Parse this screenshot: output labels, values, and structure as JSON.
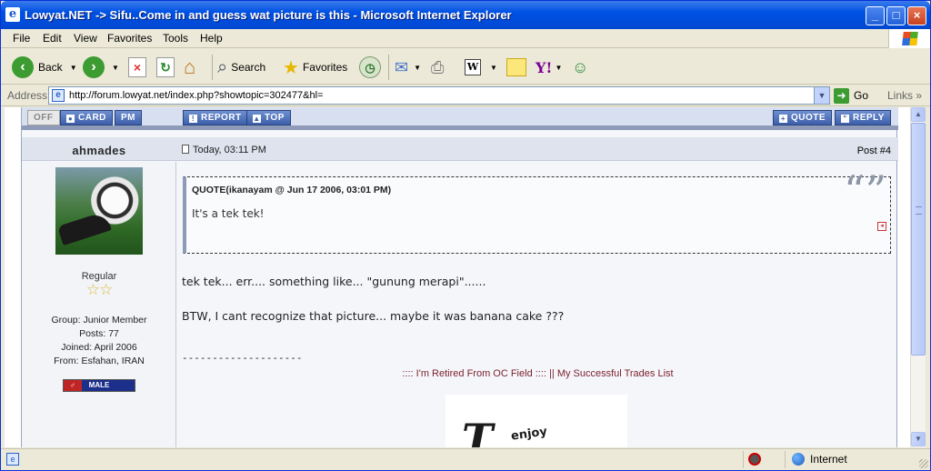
{
  "window": {
    "title": "Lowyat.NET -> Sifu..Come in and guess wat picture is this - Microsoft Internet Explorer"
  },
  "menu": [
    "File",
    "Edit",
    "View",
    "Favorites",
    "Tools",
    "Help"
  ],
  "toolbar": {
    "back": "Back",
    "search": "Search",
    "favorites": "Favorites"
  },
  "address": {
    "label": "Address",
    "url": "http://forum.lowyat.net/index.php?showtopic=302477&hl=",
    "go": "Go",
    "links": "Links"
  },
  "forum": {
    "buttons": {
      "off": "OFF",
      "card": "CARD",
      "pm": "PM",
      "report": "REPORT",
      "top": "TOP",
      "quote": "QUOTE",
      "reply": "REPLY"
    },
    "post": {
      "username": "ahmades",
      "date": "Today, 03:11 PM",
      "number": "Post #4",
      "rank": "Regular",
      "group": "Group: Junior Member",
      "posts": "Posts: 77",
      "joined": "Joined: April 2006",
      "from": "From: Esfahan, IRAN",
      "gender": "MALE",
      "quote_header": "QUOTE(ikanayam @ Jun 17 2006, 03:01 PM)",
      "quote_body": "It's a tek tek!",
      "body_line1": "tek tek... err.... something like... \"gunung merapi\"......",
      "body_line2": "BTW, I cant recognize that picture... maybe it was banana cake ???",
      "separator": "--------------------",
      "sig_part1": ":::: I'm Retired From OC Field ::::",
      "sig_divider": "||",
      "sig_part2": "My Successful Trades List",
      "sig_image_small": "enjoy"
    }
  },
  "status": {
    "zone": "Internet"
  },
  "colors": {
    "titlebar": "#0052e4",
    "forum_button": "#3d5fab",
    "signature": "#7a1f2b"
  }
}
